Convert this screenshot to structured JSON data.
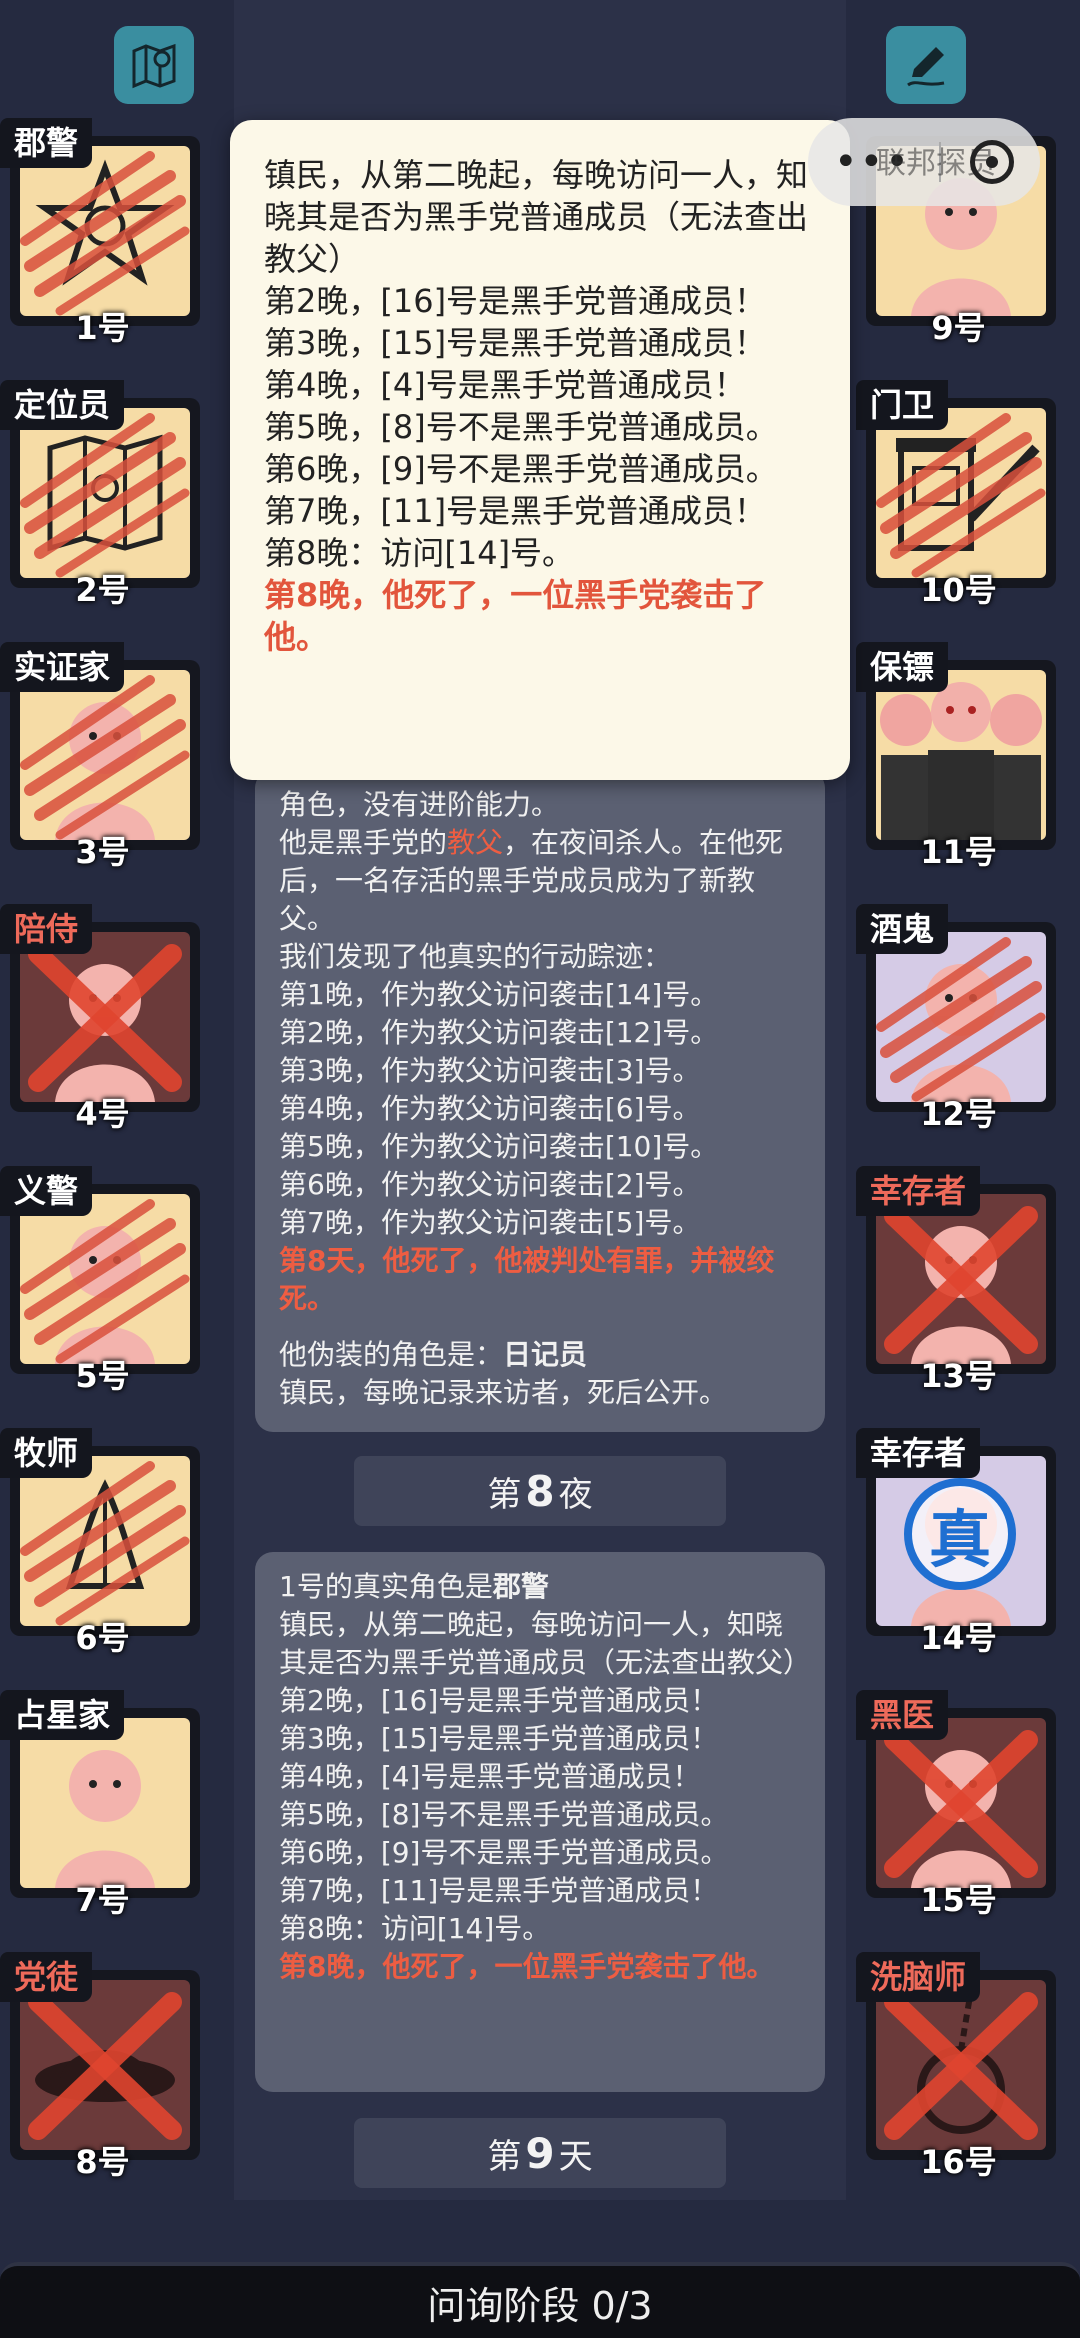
{
  "toolbar": {
    "map_icon": "map-icon",
    "edit_icon": "pencil-icon"
  },
  "capsule": {
    "hidden_label": "联邦探员",
    "more_icon": "more-dots-icon",
    "close_icon": "close-circle-icon"
  },
  "popup": {
    "lines": [
      "镇民，从第二晚起，每晚访问一人，知晓其是否为黑手党普通成员（无法查出教父）",
      "第2晚，[16]号是黑手党普通成员！",
      "第3晚，[15]号是黑手党普通成员！",
      "第4晚，[4]号是黑手党普通成员！",
      "第5晚，[8]号不是黑手党普通成员。",
      "第6晚，[9]号不是黑手党普通成员。",
      "第7晚，[11]号是黑手党普通成员！",
      "第8晚：访问[14]号。"
    ],
    "death_line": "第8晚，他死了，一位黑手党袭击了他。"
  },
  "log_card_1": {
    "partial_top": "角色，没有进阶能力。",
    "godfather_prefix": "他是黑手党的",
    "godfather_word": "教父",
    "godfather_suffix": "，在夜间杀人。在他死后，一名存活的黑手党成员成为了新教父。",
    "trace_intro": "我们发现了他真实的行动踪迹：",
    "nights": [
      "第1晚，作为教父访问袭击[14]号。",
      "第2晚，作为教父访问袭击[12]号。",
      "第3晚，作为教父访问袭击[3]号。",
      "第4晚，作为教父访问袭击[6]号。",
      "第5晚，作为教父访问袭击[10]号。",
      "第6晚，作为教父访问袭击[2]号。",
      "第7晚，作为教父访问袭击[5]号。"
    ],
    "death_line": "第8天，他死了，他被判处有罪，并被绞死。",
    "disguise_prefix": "他伪装的角色是：",
    "disguise_role": "日记员",
    "disguise_desc": "镇民，每晚记录来访者，死后公开。"
  },
  "night_banner": {
    "prefix": "第",
    "number": "8",
    "suffix": "夜"
  },
  "log_card_2": {
    "title_prefix": "1号的真实角色是",
    "title_role": "郡警",
    "lines": [
      "镇民，从第二晚起，每晚访问一人，知晓其是否为黑手党普通成员（无法查出教父）",
      "第2晚，[16]号是黑手党普通成员！",
      "第3晚，[15]号是黑手党普通成员！",
      "第4晚，[4]号是黑手党普通成员！",
      "第5晚，[8]号不是黑手党普通成员。",
      "第6晚，[9]号不是黑手党普通成员。",
      "第7晚，[11]号是黑手党普通成员！",
      "第8晚：访问[14]号。"
    ],
    "death_line": "第8晚，他死了，一位黑手党袭击了他。"
  },
  "day_banner": {
    "prefix": "第",
    "number": "9",
    "suffix": "天"
  },
  "players_left": [
    {
      "role": "郡警",
      "number": "1号",
      "status": "clawed",
      "icon": "sheriff-badge-icon"
    },
    {
      "role": "定位员",
      "number": "2号",
      "status": "clawed",
      "icon": "map-pin-icon"
    },
    {
      "role": "实证家",
      "number": "3号",
      "status": "clawed",
      "icon": "confused-person-icon"
    },
    {
      "role": "陪侍",
      "number": "4号",
      "status": "crossed",
      "icon": "escort-icon"
    },
    {
      "role": "义警",
      "number": "5号",
      "status": "clawed",
      "icon": "vigilante-gun-icon"
    },
    {
      "role": "牧师",
      "number": "6号",
      "status": "clawed",
      "icon": "praying-hands-icon"
    },
    {
      "role": "占星家",
      "number": "7号",
      "status": "alive",
      "icon": "astrologer-icon"
    },
    {
      "role": "党徒",
      "number": "8号",
      "status": "crossed",
      "icon": "mafia-hat-icon"
    }
  ],
  "players_right": [
    {
      "role": "",
      "number": "9号",
      "status": "alive",
      "icon": "fbi-agent-icon"
    },
    {
      "role": "门卫",
      "number": "10号",
      "status": "clawed",
      "icon": "gate-booth-icon"
    },
    {
      "role": "保镖",
      "number": "11号",
      "status": "alive",
      "icon": "bodyguards-icon"
    },
    {
      "role": "酒鬼",
      "number": "12号",
      "status": "clawed",
      "icon": "drunk-icon"
    },
    {
      "role": "幸存者",
      "number": "13号",
      "status": "crossed",
      "icon": "survivor-icon"
    },
    {
      "role": "幸存者",
      "number": "14号",
      "status": "revealed",
      "icon": "survivor-icon",
      "badge": "真"
    },
    {
      "role": "黑医",
      "number": "15号",
      "status": "crossed",
      "icon": "dark-doctor-icon"
    },
    {
      "role": "洗脑师",
      "number": "16号",
      "status": "crossed",
      "icon": "pocket-watch-icon"
    }
  ],
  "bottom_bar": {
    "label": "问询阶段 0/3"
  },
  "colors": {
    "background": "#252a40",
    "card": "#5b6072",
    "accent_red": "#ee5d42",
    "portrait_bg": "#f6dca6",
    "popup_bg": "#fcf8e8",
    "top_icon": "#3a8ea0"
  }
}
